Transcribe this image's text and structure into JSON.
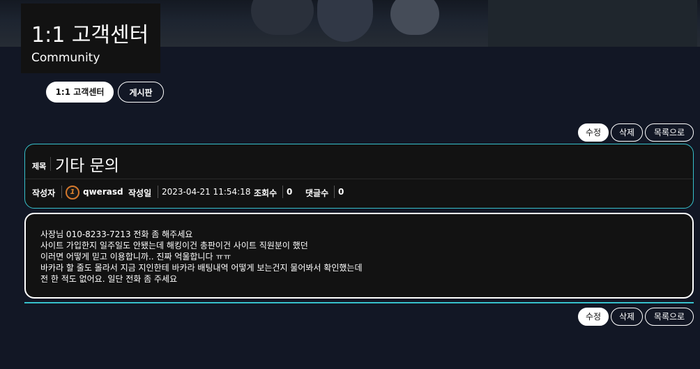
{
  "header": {
    "title": "1:1 고객센터",
    "subtitle": "Community"
  },
  "tabs": [
    {
      "label": "1:1 고객센터",
      "active": true
    },
    {
      "label": "게시판",
      "active": false
    }
  ],
  "actions": {
    "edit": "수정",
    "delete": "삭제",
    "list": "목록으로"
  },
  "post": {
    "subject_label": "제목",
    "subject": "기타 문의",
    "author_label": "작성자",
    "author": "qwerasd",
    "author_level_icon": "level-1-icon",
    "date_label": "작성일",
    "date": "2023-04-21 11:54:18",
    "views_label": "조회수",
    "views": "0",
    "comments_label": "댓글수",
    "comments": "0",
    "body": [
      "사장님 010-8233-7213 전화 좀 해주세요",
      "사이트 가입한지 일주일도 안됐는데 해킹이건 총판이건 사이트 직원분이 했던",
      "이러면 어떻게 믿고 이용합니까.. 진짜 억울합니다 ㅠㅠ",
      "바카라 할 줄도 몰라서 지금 지인한테 바카라 배팅내역 어떻게 보는건지 물어봐서 확인했는데",
      "전 한 적도 없어요. 일단 전화 좀 주세요"
    ]
  },
  "colors": {
    "background": "#121725",
    "accent": "#37c1cc",
    "level_badge": "#e0862e"
  }
}
